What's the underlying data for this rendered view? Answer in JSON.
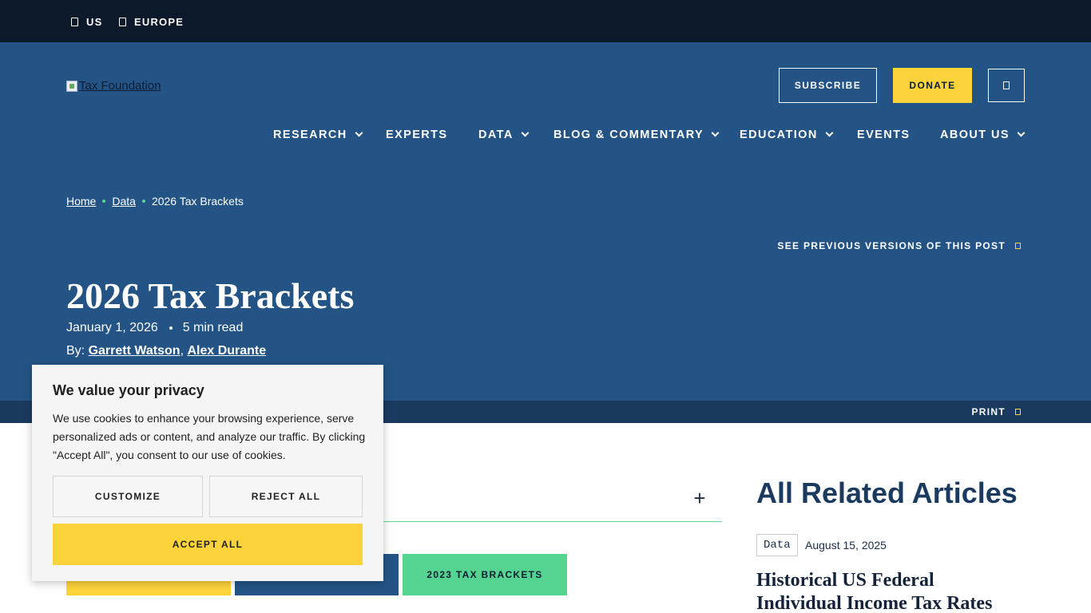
{
  "topbar": {
    "regions": [
      {
        "label": "US"
      },
      {
        "label": "EUROPE"
      }
    ]
  },
  "header": {
    "logo_alt": "Tax Foundation",
    "subscribe_label": "SUBSCRIBE",
    "donate_label": "DONATE"
  },
  "nav": {
    "items": [
      {
        "label": "RESEARCH",
        "has_dropdown": true
      },
      {
        "label": "EXPERTS",
        "has_dropdown": false
      },
      {
        "label": "DATA",
        "has_dropdown": true
      },
      {
        "label": "BLOG & COMMENTARY",
        "has_dropdown": true
      },
      {
        "label": "EDUCATION",
        "has_dropdown": true
      },
      {
        "label": "EVENTS",
        "has_dropdown": false
      },
      {
        "label": "ABOUT US",
        "has_dropdown": true
      }
    ]
  },
  "breadcrumb": {
    "items": [
      "Home",
      "Data"
    ],
    "current": "2026 Tax Brackets"
  },
  "article": {
    "previous_versions_label": "SEE PREVIOUS VERSIONS OF THIS POST",
    "title": "2026 Tax Brackets",
    "date": "January 1, 2026",
    "read_time": "5 min read",
    "by_label": "By:",
    "authors": [
      "Garrett Watson",
      "Alex Durante"
    ],
    "print_label": "PRINT",
    "related_buttons": [
      {
        "label": ""
      },
      {
        "label": ""
      },
      {
        "label": "2023 TAX BRACKETS"
      }
    ]
  },
  "related": {
    "heading": "All Related Articles",
    "items": [
      {
        "tag": "Data",
        "date": "August 15, 2025",
        "title": "Historical US Federal Individual Income Tax Rates"
      }
    ]
  },
  "cookie": {
    "title": "We value your privacy",
    "text": "We use cookies to enhance your browsing experience, serve personalized ads or content, and analyze our traffic. By clicking \"Accept All\", you consent to our use of cookies.",
    "customize_label": "CUSTOMIZE",
    "reject_label": "REJECT ALL",
    "accept_label": "ACCEPT ALL"
  },
  "colors": {
    "topbar": "#0b192b",
    "hero": "#245485",
    "print_bar": "#1a3a5f",
    "accent_yellow": "#fdd33c",
    "accent_green": "#55d391"
  }
}
